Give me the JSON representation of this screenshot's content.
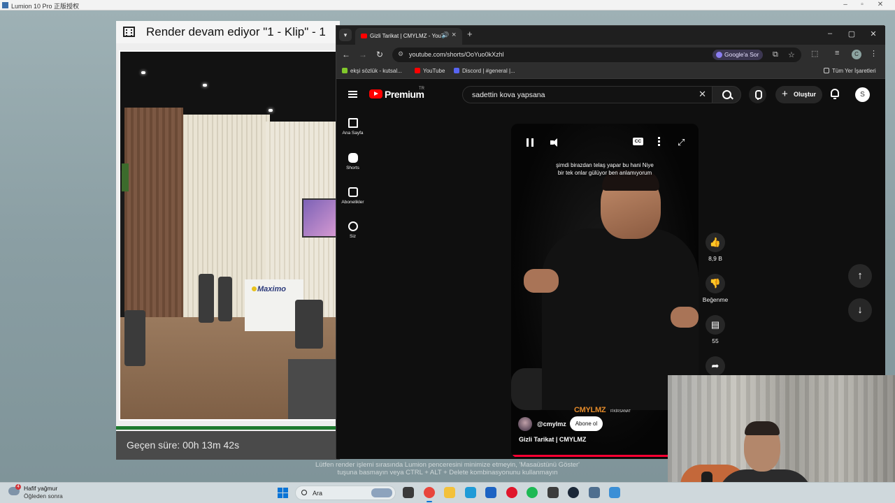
{
  "lumion": {
    "window_title": "Lumion 10 Pro 正版授权",
    "render_title": "Render devam ediyor \"1 - Klip\" - 1",
    "elapsed_label": "Geçen süre: 00h 13m 42s",
    "progress_fraction": 1.0,
    "preview_logo": "Maximo",
    "notice_line1": "Lütfen render işlemi sırasında Lumion penceresini minimize etmeyin, 'Masaüstünü Göster'",
    "notice_line2": "tuşuna basmayın veya CTRL + ALT + Delete kombinasyonunu kullanmayın"
  },
  "chrome": {
    "tab_title": "Gizli Tarikat | CMYLMZ - YouTube",
    "address": "youtube.com/shorts/OoYuo0kXzhl",
    "ask_google": "Google'a Sor",
    "profile_initial": "C",
    "bookmarks": [
      {
        "label": "ekşi sözlük - kutsal...",
        "color": "#81c82b"
      },
      {
        "label": "YouTube",
        "color": "#ff0000"
      },
      {
        "label": "Discord | #general |...",
        "color": "#5865f2"
      }
    ],
    "all_bookmarks": "Tüm Yer İşaretleri"
  },
  "youtube": {
    "brand": "Premium",
    "region": "TR",
    "search_query": "sadettin kova yapsana",
    "create_label": "Oluştur",
    "avatar_initial": "S",
    "nav": [
      {
        "label": "Ana Sayfa",
        "icon": "home-icon"
      },
      {
        "label": "Shorts",
        "icon": "shorts-icon"
      },
      {
        "label": "Abonelikler",
        "icon": "subscriptions-icon"
      },
      {
        "label": "Siz",
        "icon": "you-icon"
      }
    ],
    "caption_line1": "şimdi birazdan telaş yapar bu hani Niye",
    "caption_line2": "bir tek onlar gülüyor ben anlamıyorum",
    "cc_label": "CC",
    "watermark_main": "CMYLMZ",
    "watermark_sub": "FİKİRSANAT",
    "channel_handle": "@cmylmz",
    "subscribe_label": "Abone ol",
    "video_title": "Gizli Tarikat | CMYLMZ",
    "video_progress": 0.86,
    "likes": "8,9 B",
    "dislike_label": "Beğenme",
    "comments": "55",
    "accent": "#ff0000"
  },
  "taskbar": {
    "weather_line1": "Hafif yağmur",
    "weather_line2": "Öğleden sonra",
    "weather_badge": "4",
    "search_placeholder": "Ara",
    "apps": [
      {
        "icon": "task-view-icon",
        "color": "#3a3a3a"
      },
      {
        "icon": "chrome-icon",
        "color": "#e8453c"
      },
      {
        "icon": "file-explorer-icon",
        "color": "#f3c13a"
      },
      {
        "icon": "edge-icon",
        "color": "#1f9bd7"
      },
      {
        "icon": "outlook-icon",
        "color": "#1c63c3"
      },
      {
        "icon": "opera-icon",
        "color": "#e0162b"
      },
      {
        "icon": "spotify-icon",
        "color": "#1db954"
      },
      {
        "icon": "app-icon",
        "color": "#3c3c3c"
      },
      {
        "icon": "steam-icon",
        "color": "#1b2838"
      },
      {
        "icon": "lumion-icon",
        "color": "#4f6f8f"
      },
      {
        "icon": "app-icon",
        "color": "#3b8fd6"
      }
    ]
  }
}
